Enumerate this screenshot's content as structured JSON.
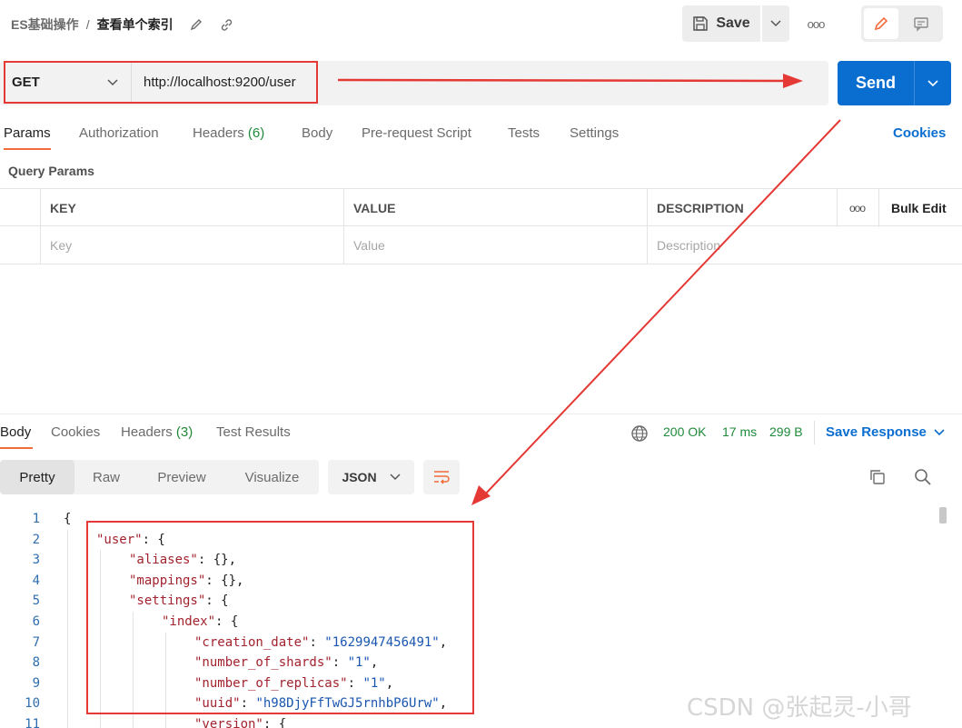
{
  "header": {
    "breadcrumb_parent": "ES基础操作",
    "breadcrumb_separator": "/",
    "breadcrumb_current": "查看单个索引",
    "save_label": "Save",
    "more_label": "ooo"
  },
  "request": {
    "method": "GET",
    "url": "http://localhost:9200/user",
    "send_label": "Send"
  },
  "request_tabs": [
    {
      "label": "Params",
      "count": ""
    },
    {
      "label": "Authorization",
      "count": ""
    },
    {
      "label": "Headers",
      "count": "(6)"
    },
    {
      "label": "Body",
      "count": ""
    },
    {
      "label": "Pre-request Script",
      "count": ""
    },
    {
      "label": "Tests",
      "count": ""
    },
    {
      "label": "Settings",
      "count": ""
    }
  ],
  "cookies_label": "Cookies",
  "query_params": {
    "title": "Query Params",
    "columns": [
      "KEY",
      "VALUE",
      "DESCRIPTION"
    ],
    "more_label": "ooo",
    "bulk_edit_label": "Bulk Edit",
    "placeholders": [
      "Key",
      "Value",
      "Description"
    ]
  },
  "response": {
    "tabs": [
      {
        "label": "Body",
        "count": ""
      },
      {
        "label": "Cookies",
        "count": ""
      },
      {
        "label": "Headers",
        "count": "(3)"
      },
      {
        "label": "Test Results",
        "count": ""
      }
    ],
    "status": "200 OK",
    "time": "17 ms",
    "size": "299 B",
    "save_response_label": "Save Response",
    "formats": [
      "Pretty",
      "Raw",
      "Preview",
      "Visualize"
    ],
    "language": "JSON",
    "code_lines": [
      {
        "n": "1",
        "indent": 0,
        "parts": [
          [
            "p",
            "{"
          ]
        ]
      },
      {
        "n": "2",
        "indent": 1,
        "parts": [
          [
            "k",
            "\"user\""
          ],
          [
            "p",
            ": {"
          ]
        ]
      },
      {
        "n": "3",
        "indent": 2,
        "parts": [
          [
            "k",
            "\"aliases\""
          ],
          [
            "p",
            ": {},"
          ]
        ]
      },
      {
        "n": "4",
        "indent": 2,
        "parts": [
          [
            "k",
            "\"mappings\""
          ],
          [
            "p",
            ": {},"
          ]
        ]
      },
      {
        "n": "5",
        "indent": 2,
        "parts": [
          [
            "k",
            "\"settings\""
          ],
          [
            "p",
            ": {"
          ]
        ]
      },
      {
        "n": "6",
        "indent": 3,
        "parts": [
          [
            "k",
            "\"index\""
          ],
          [
            "p",
            ": {"
          ]
        ]
      },
      {
        "n": "7",
        "indent": 4,
        "parts": [
          [
            "k",
            "\"creation_date\""
          ],
          [
            "p",
            ": "
          ],
          [
            "s",
            "\"1629947456491\""
          ],
          [
            "p",
            ","
          ]
        ]
      },
      {
        "n": "8",
        "indent": 4,
        "parts": [
          [
            "k",
            "\"number_of_shards\""
          ],
          [
            "p",
            ": "
          ],
          [
            "s",
            "\"1\""
          ],
          [
            "p",
            ","
          ]
        ]
      },
      {
        "n": "9",
        "indent": 4,
        "parts": [
          [
            "k",
            "\"number_of_replicas\""
          ],
          [
            "p",
            ": "
          ],
          [
            "s",
            "\"1\""
          ],
          [
            "p",
            ","
          ]
        ]
      },
      {
        "n": "10",
        "indent": 4,
        "parts": [
          [
            "k",
            "\"uuid\""
          ],
          [
            "p",
            ": "
          ],
          [
            "s",
            "\"h98DjyFfTwGJ5rnhbP6Urw\""
          ],
          [
            "p",
            ","
          ]
        ]
      },
      {
        "n": "11",
        "indent": 4,
        "parts": [
          [
            "k",
            "\"version\""
          ],
          [
            "p",
            ": {"
          ]
        ]
      }
    ]
  },
  "watermark": "CSDN @张起灵-小哥",
  "colors": {
    "accent": "#f26b3a",
    "send_blue": "#0a6ed1",
    "status_green": "#1f8a3a",
    "annotation_red": "#e53935"
  }
}
